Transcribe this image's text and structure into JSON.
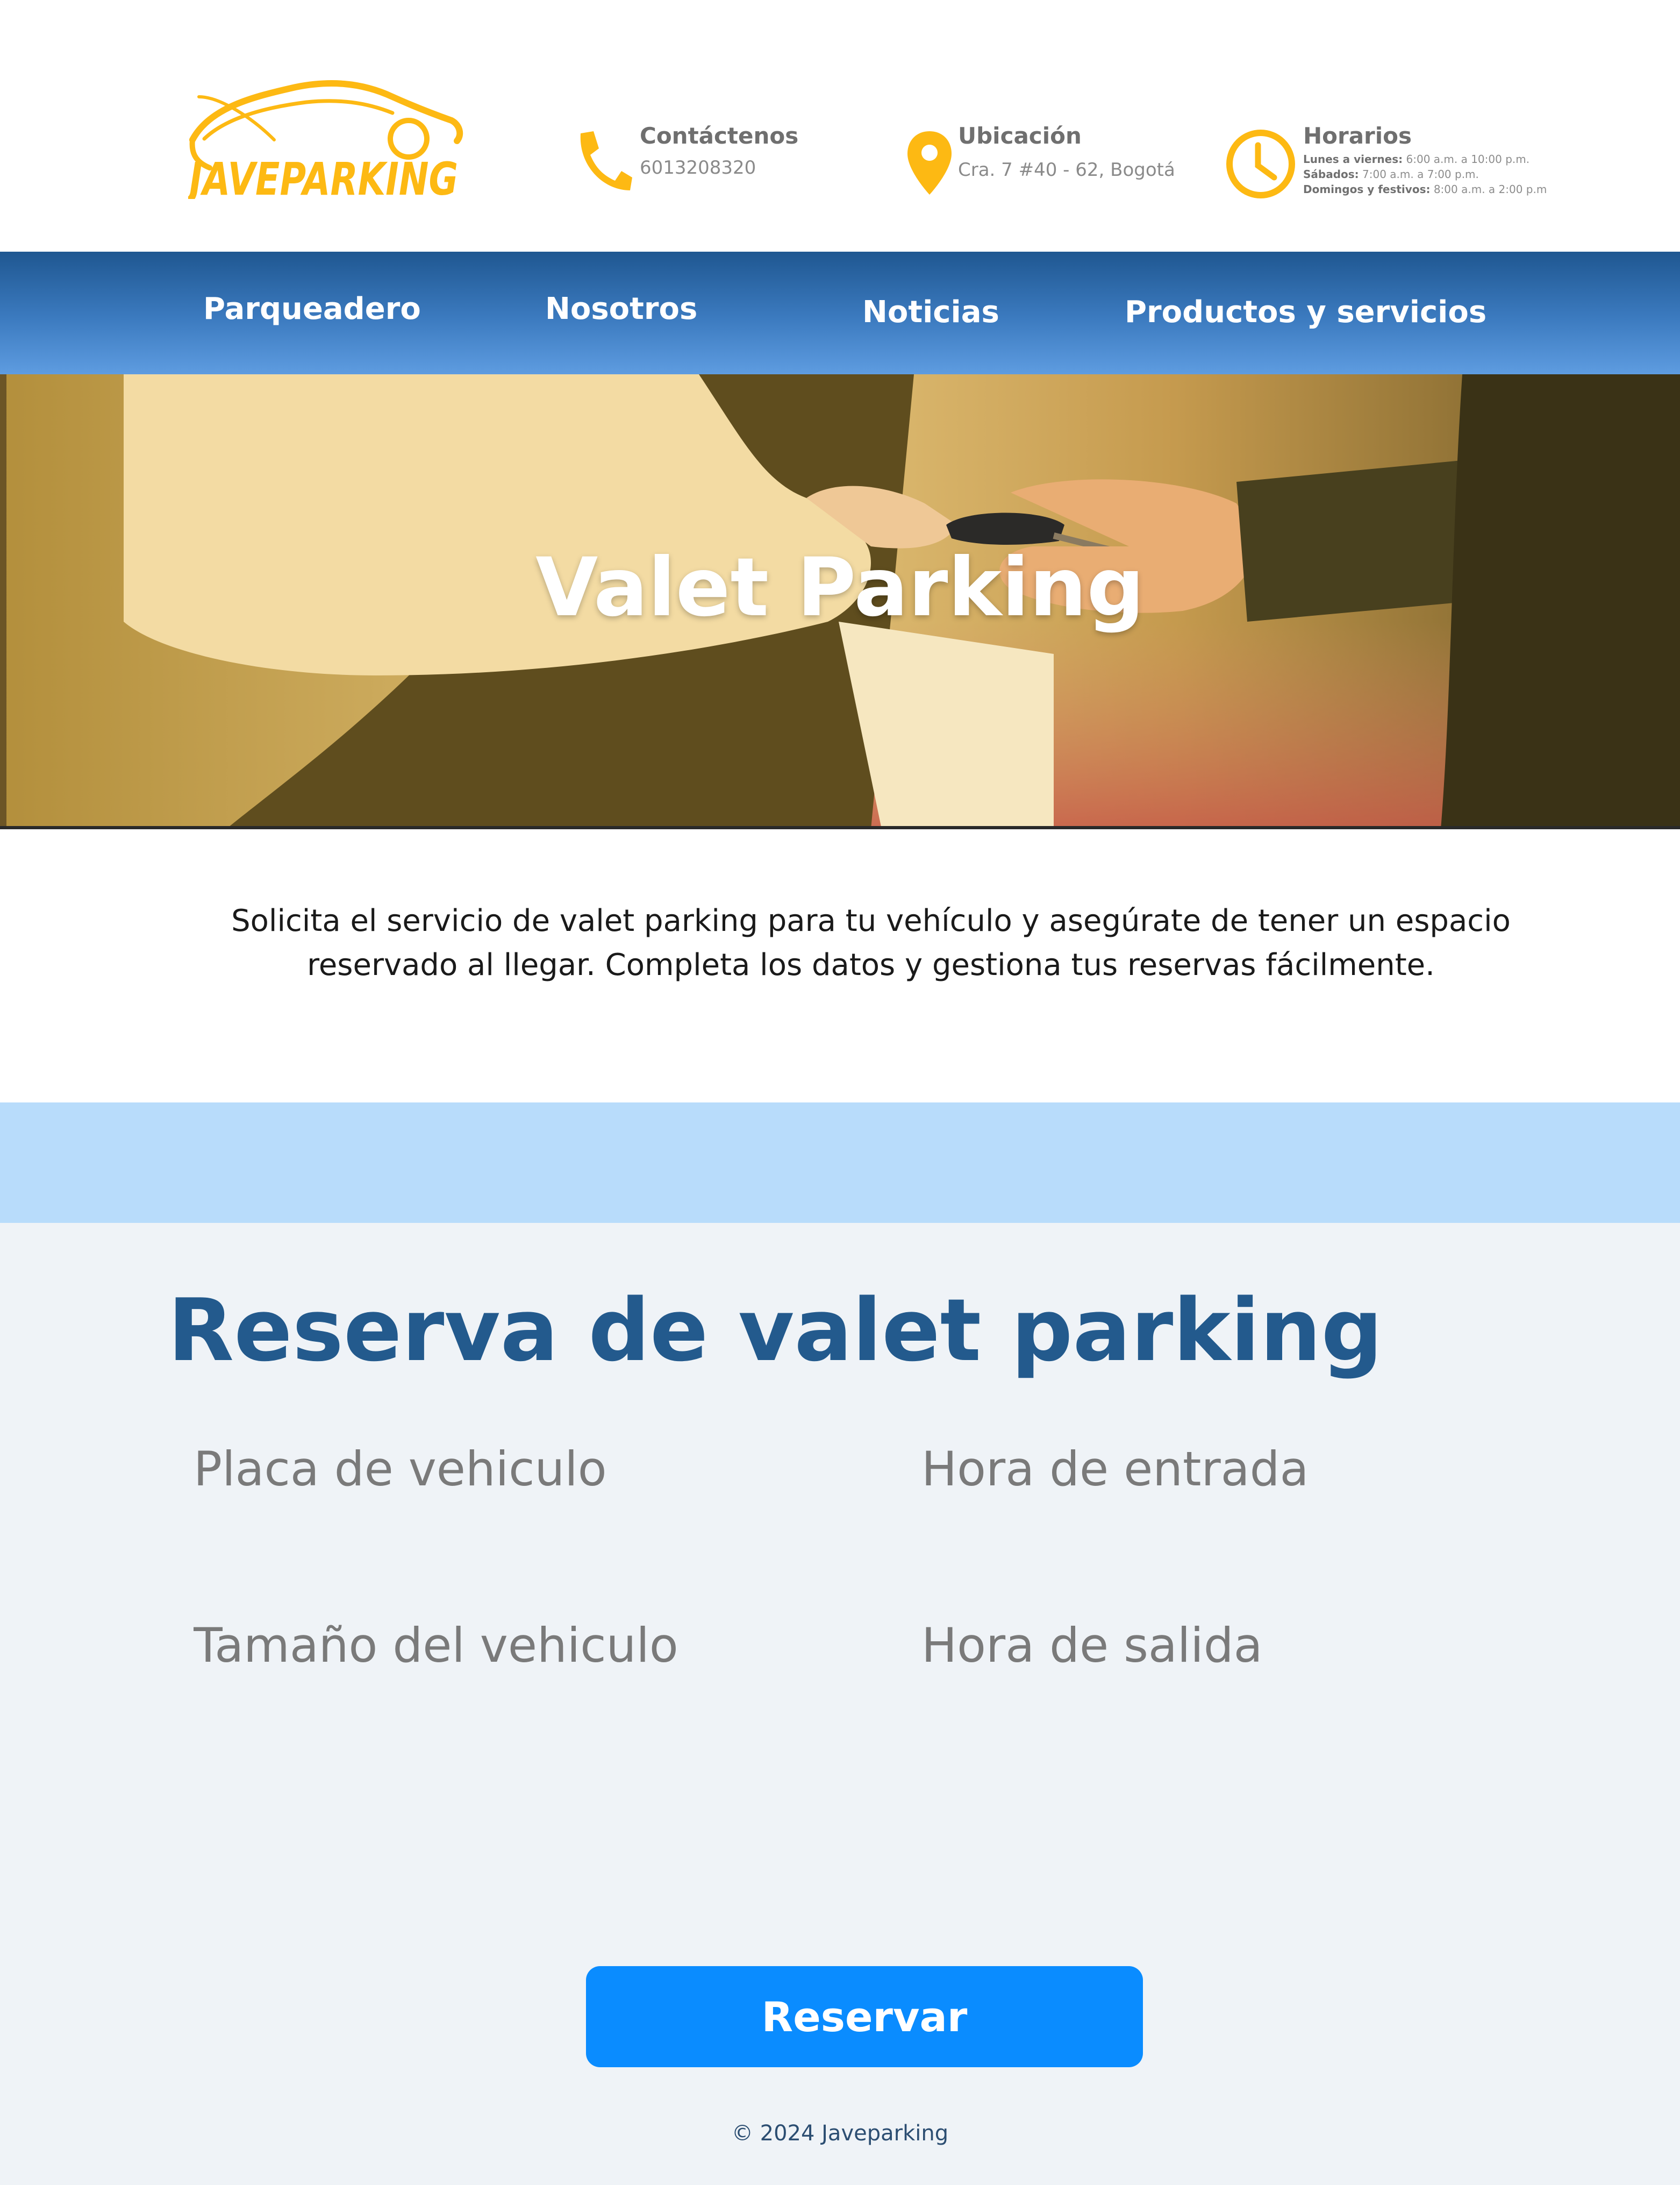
{
  "header": {
    "logo_text": "JAVEPARKING",
    "contact": {
      "title": "Contáctenos",
      "text": "6013208320",
      "icon": "phone-icon"
    },
    "location": {
      "title": "Ubicación",
      "text": "Cra. 7 #40 - 62, Bogotá",
      "icon": "map-pin-icon"
    },
    "hours": {
      "title": "Horarios",
      "icon": "clock-icon",
      "rows": [
        {
          "label": "Lunes a viernes:",
          "value": "6:00 a.m. a 10:00 p.m."
        },
        {
          "label": "Sábados:",
          "value": "7:00 a.m. a 7:00 p.m."
        },
        {
          "label": "Domingos y festivos:",
          "value": "8:00 a.m. a 2:00 p.m"
        }
      ]
    }
  },
  "nav": {
    "items": [
      "Parqueadero",
      "Nosotros",
      "Noticias",
      "Productos y servicios"
    ]
  },
  "hero": {
    "title": "Valet Parking"
  },
  "intro": {
    "line1": "Solicita el servicio de valet parking para tu vehículo y asegúrate de tener un espacio",
    "line2": "reservado al llegar. Completa los datos y gestiona tus reservas fácilmente."
  },
  "form": {
    "title": "Reserva de valet parking",
    "plate_placeholder": "Placa de vehiculo",
    "entry_placeholder": "Hora de entrada",
    "size_placeholder": "Tamaño del vehiculo",
    "exit_placeholder": "Hora de salida",
    "submit_label": "Reservar"
  },
  "footer": {
    "text": "© 2024 Javeparking"
  },
  "colors": {
    "brand_yellow": "#fdb913",
    "nav_blue": "#2a66a6",
    "title_blue": "#235a8d",
    "button_blue": "#0a8cff",
    "band_blue": "#b8dcfb"
  }
}
